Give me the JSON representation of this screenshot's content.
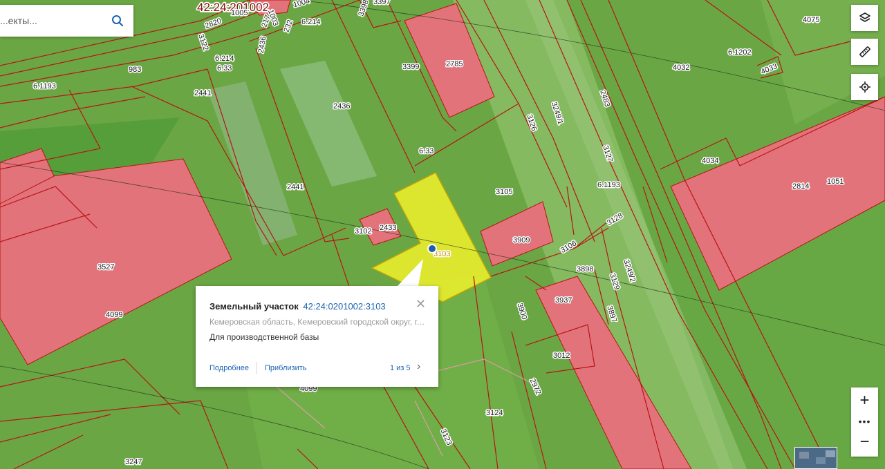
{
  "search": {
    "placeholder": "...екты...",
    "icon": "search-icon"
  },
  "map": {
    "quarter_label": "42:24:201002",
    "selected_parcel_label": "3103",
    "parcel_labels": [
      "2436",
      "2441",
      "2441",
      "3102",
      "2433",
      "3527",
      "4099",
      "983",
      "2785",
      "3399",
      "3249/1",
      "3126",
      "2483",
      "3127",
      "3105",
      "3909",
      "3106",
      "3898",
      "3128",
      "3249/2",
      "3129",
      "3937",
      "3897",
      "3900",
      "3012",
      "2972",
      "3124",
      "3123",
      "3247",
      "4099",
      "4032",
      "4075",
      "4033",
      "4034",
      "2814",
      "1051",
      "3122",
      "2820",
      "1003",
      "1004",
      "232",
      "217",
      "2436",
      "1005",
      "3398",
      "3397"
    ],
    "zone_labels": [
      "6.214",
      "6.214",
      "6.33",
      "6.1193",
      "6.33",
      "6.1193",
      "6.1202"
    ],
    "colors": {
      "zone_fill": "#58ad38",
      "building_fill": "#e3737a",
      "boundary": "#b81414",
      "selected_fill": "#e6ec2e",
      "accent": "#1a63b0"
    }
  },
  "controls": {
    "layers_icon": "layers-icon",
    "ruler_icon": "ruler-icon",
    "locate_icon": "crosshair-icon",
    "zoom_in": "+",
    "more": "•••",
    "zoom_out": "−"
  },
  "popup": {
    "title": "Земельный участок",
    "cadastral_number": "42:24:0201002:3103",
    "address": "Кемеровская область, Кемеровский городской округ, г. Кемерово",
    "permitted_use": "Для производственной базы",
    "more_link": "Подробнее",
    "zoom_link": "Приблизить",
    "pager": "1 из 5",
    "close": "✕",
    "next": "›"
  }
}
